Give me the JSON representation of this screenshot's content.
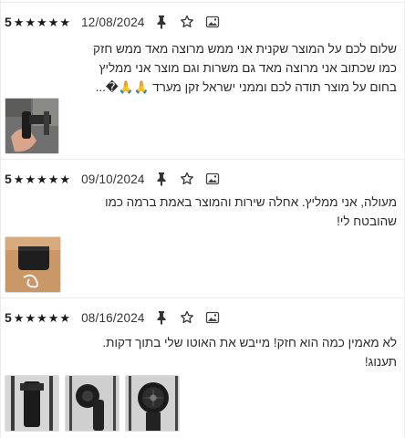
{
  "reviews": [
    {
      "rating": "5",
      "date": "12/08/2024",
      "text_lines": [
        "שלום לכם על המוצר שקנית אני ממש מרוצה מאד ממש חזק",
        "כמו שכתוב אני מרוצה מאד גם משרות וגם מוצר אני ממליץ",
        "בחום על מוצר תודה לכם וממני ישראל זקן מערד 🙏🙏�..."
      ],
      "images": [
        "photo-handheld-fan-in-hand"
      ]
    },
    {
      "rating": "5",
      "date": "09/10/2024",
      "text_lines": [
        "מעולה, אני ממליץ. אחלה שירות והמוצר באמת ברמה כמו",
        "שהובטח לי!"
      ],
      "images": [
        "photo-fan-with-cable"
      ]
    },
    {
      "rating": "5",
      "date": "08/16/2024",
      "text_lines": [
        "לא מאמין כמה הוא חזק! מייבש את האוטו שלי בתוך דקות.",
        "תענוג!"
      ],
      "images": [
        "photo-fan-side-view",
        "photo-fan-nozzle",
        "photo-fan-blades"
      ]
    }
  ],
  "icons": {
    "star": "star-filled-icon",
    "pin": "pin-icon",
    "favorite": "star-outline-icon",
    "image": "image-icon"
  },
  "colors": {
    "stars": "#1a1a1a",
    "divider": "#ececec",
    "text": "#2a2a2a"
  }
}
